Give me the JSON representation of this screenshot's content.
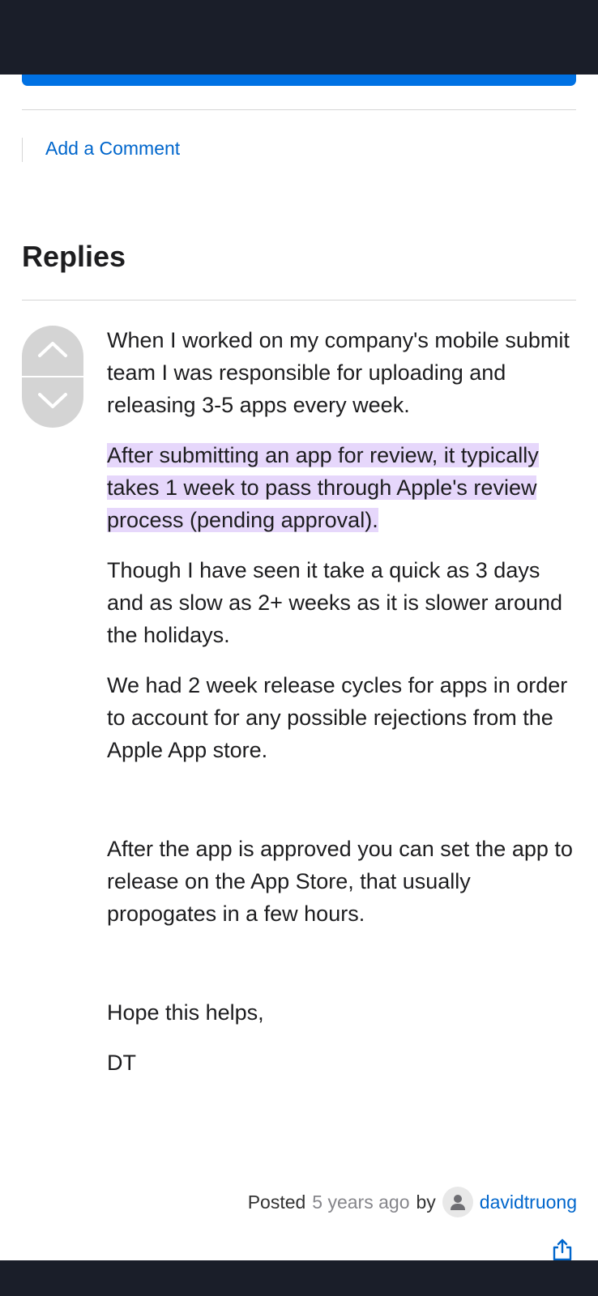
{
  "comment_link": "Add a Comment",
  "replies_heading": "Replies",
  "post": {
    "paragraphs": [
      "When I worked on my company's mobile submit team I was responsible for uploading and releasing 3-5 apps every week.",
      "After submitting an app for review, it typically takes 1 week to pass through Apple's review process (pending approval).",
      "Though I have seen it take a quick as 3 days and as slow as 2+ weeks as it is slower around the holidays.",
      "We had 2 week release cycles for apps in order to account for any possible rejections from the Apple App store.",
      "After the app is approved you can set the app to release on the App Store, that usually propogates in a few hours.",
      "Hope this helps,",
      "DT"
    ]
  },
  "meta": {
    "posted_label": "Posted",
    "time": "5 years ago",
    "by_label": "by",
    "author": "davidtruong"
  },
  "icons": {
    "vote_up": "chevron-up-icon",
    "vote_down": "chevron-down-icon",
    "avatar": "user-icon",
    "share": "share-icon"
  },
  "colors": {
    "link": "#0066cc",
    "highlight": "#e6d7fb",
    "header_bar": "#1a1e29",
    "accent": "#0071e3"
  }
}
